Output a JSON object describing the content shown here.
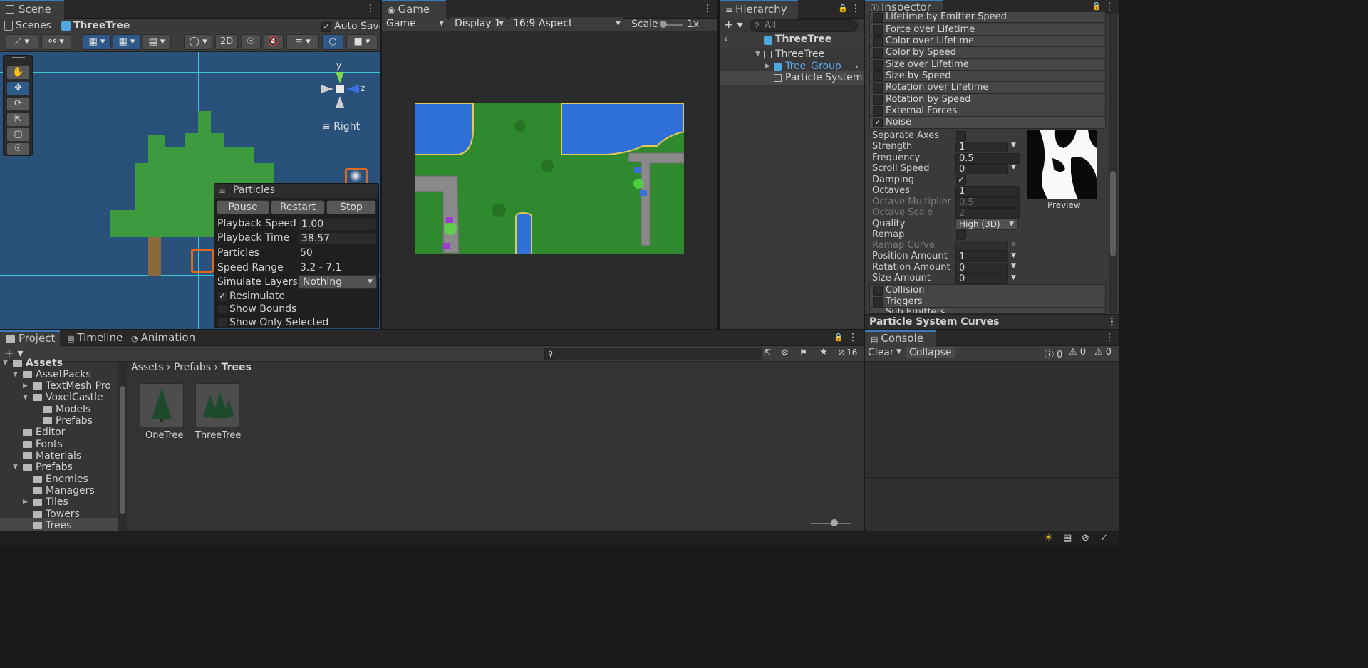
{
  "scene": {
    "tab": "Scene",
    "breadcrumb_root": "Scenes",
    "breadcrumb_current": "ThreeTree",
    "auto_save": "Auto Save",
    "mode_2d": "2D",
    "view_label": "Right",
    "gizmo_y": "y",
    "gizmo_z": "z"
  },
  "particles": {
    "title": "Particles",
    "pause": "Pause",
    "restart": "Restart",
    "stop": "Stop",
    "rows": [
      {
        "label": "Playback Speed",
        "value": "1.00"
      },
      {
        "label": "Playback Time",
        "value": "38.57"
      },
      {
        "label": "Particles",
        "value": "50"
      },
      {
        "label": "Speed Range",
        "value": "3.2 - 7.1"
      },
      {
        "label": "Simulate Layers",
        "value": "Nothing"
      }
    ],
    "resimulate": "Resimulate",
    "show_bounds": "Show Bounds",
    "show_only_selected": "Show Only Selected"
  },
  "game": {
    "tab": "Game",
    "mode": "Game",
    "display": "Display 1",
    "aspect": "16:9 Aspect",
    "scale_label": "Scale",
    "scale_value": "1x"
  },
  "hierarchy": {
    "tab": "Hierarchy",
    "search_placeholder": "All",
    "prefab_title": "ThreeTree",
    "items": [
      "ThreeTree",
      "Tree_Group",
      "Particle System"
    ]
  },
  "inspector": {
    "tab": "Inspector",
    "modules_top": [
      {
        "label": "Lifetime by Emitter Speed",
        "checked": false
      },
      {
        "label": "Force over Lifetime",
        "checked": false
      },
      {
        "label": "Color over Lifetime",
        "checked": false
      },
      {
        "label": "Color by Speed",
        "checked": false
      },
      {
        "label": "Size over Lifetime",
        "checked": false
      },
      {
        "label": "Size by Speed",
        "checked": false
      },
      {
        "label": "Rotation over Lifetime",
        "checked": false
      },
      {
        "label": "Rotation by Speed",
        "checked": false
      },
      {
        "label": "External Forces",
        "checked": false
      },
      {
        "label": "Noise",
        "checked": true
      }
    ],
    "noise": {
      "separate_axes": "Separate Axes",
      "strength": "Strength",
      "strength_val": "1",
      "frequency": "Frequency",
      "frequency_val": "0.5",
      "scroll_speed": "Scroll Speed",
      "scroll_speed_val": "0",
      "damping": "Damping",
      "octaves": "Octaves",
      "octaves_val": "1",
      "octave_multiplier": "Octave Multiplier",
      "octave_multiplier_val": "0.5",
      "octave_scale": "Octave Scale",
      "octave_scale_val": "2",
      "quality": "Quality",
      "quality_val": "High (3D)",
      "remap": "Remap",
      "remap_curve": "Remap Curve",
      "position_amount": "Position Amount",
      "position_amount_val": "1",
      "rotation_amount": "Rotation Amount",
      "rotation_amount_val": "0",
      "size_amount": "Size Amount",
      "size_amount_val": "0",
      "preview": "Preview"
    },
    "modules_bottom": [
      {
        "label": "Collision",
        "checked": false
      },
      {
        "label": "Triggers",
        "checked": false
      },
      {
        "label": "Sub Emitters",
        "checked": false
      }
    ],
    "curves_title": "Particle System Curves"
  },
  "project": {
    "tabs": [
      "Project",
      "Timeline",
      "Animation"
    ],
    "hidden_count": "16",
    "tree": [
      {
        "label": "Assets",
        "depth": 0,
        "arrow": "down"
      },
      {
        "label": "AssetPacks",
        "depth": 1,
        "arrow": "down"
      },
      {
        "label": "TextMesh Pro",
        "depth": 2,
        "arrow": "right"
      },
      {
        "label": "VoxelCastle",
        "depth": 2,
        "arrow": "down"
      },
      {
        "label": "Models",
        "depth": 3,
        "arrow": ""
      },
      {
        "label": "Prefabs",
        "depth": 3,
        "arrow": ""
      },
      {
        "label": "Editor",
        "depth": 1,
        "arrow": ""
      },
      {
        "label": "Fonts",
        "depth": 1,
        "arrow": ""
      },
      {
        "label": "Materials",
        "depth": 1,
        "arrow": ""
      },
      {
        "label": "Prefabs",
        "depth": 1,
        "arrow": "down"
      },
      {
        "label": "Enemies",
        "depth": 2,
        "arrow": ""
      },
      {
        "label": "Managers",
        "depth": 2,
        "arrow": ""
      },
      {
        "label": "Tiles",
        "depth": 2,
        "arrow": "right"
      },
      {
        "label": "Towers",
        "depth": 2,
        "arrow": ""
      },
      {
        "label": "Trees",
        "depth": 2,
        "arrow": ""
      }
    ],
    "path": [
      "Assets",
      "Prefabs",
      "Trees"
    ],
    "assets": [
      "OneTree",
      "ThreeTree"
    ]
  },
  "console": {
    "tab": "Console",
    "clear": "Clear",
    "collapse": "Collapse",
    "info_count": "0",
    "warn_count": "0",
    "error_count": "0"
  },
  "colors": {
    "accent": "#3a79bb",
    "scene_bg": "#29517a",
    "tree_green": "#3e9a3f",
    "trunk": "#8a6a3a",
    "selection_orange": "#e06a1c"
  }
}
